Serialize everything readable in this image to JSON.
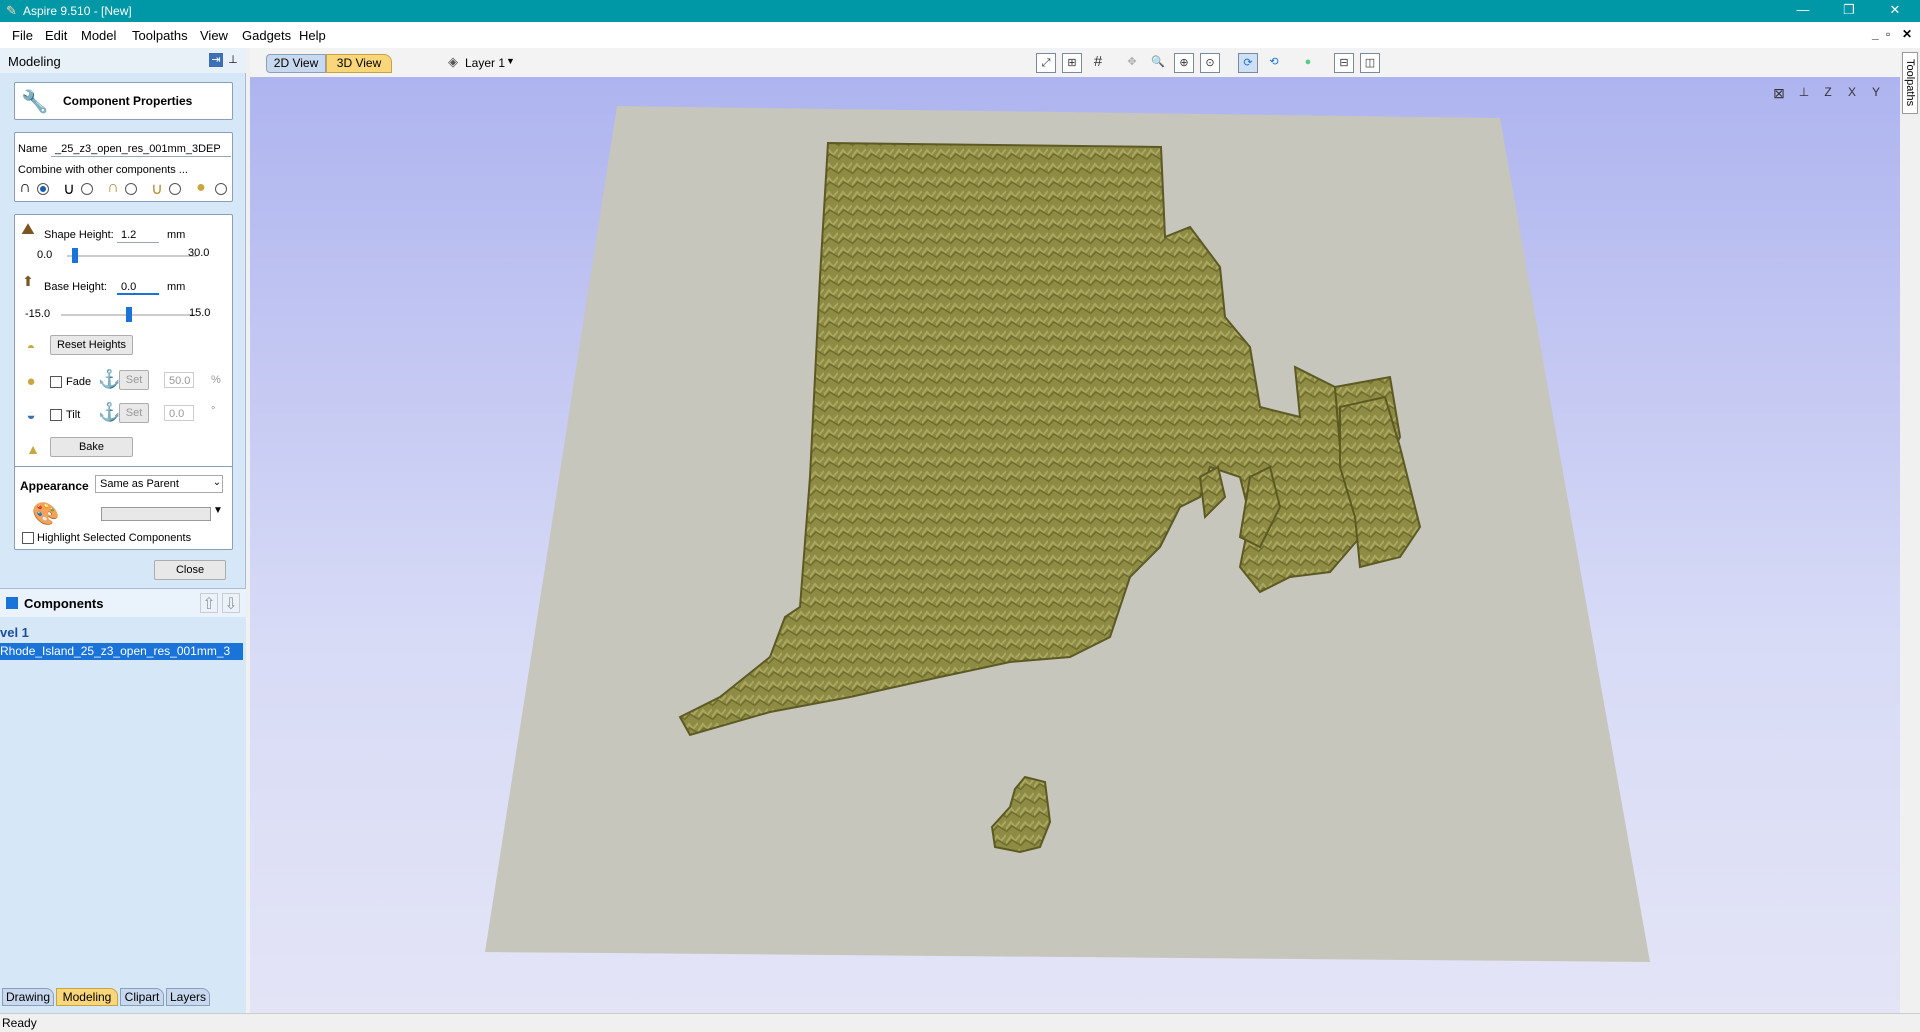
{
  "window": {
    "title": "Aspire 9.510 - [New]"
  },
  "menu": [
    "File",
    "Edit",
    "Model",
    "Toolpaths",
    "View",
    "Gadgets",
    "Help"
  ],
  "panel": {
    "title": "Modeling",
    "component_properties": {
      "heading": "Component Properties",
      "name_label": "Name",
      "name_value": "_25_z3_open_res_001mm_3DEP",
      "combine_label": "Combine with other components ...",
      "shape_height_label": "Shape Height:",
      "shape_height_value": "1.2",
      "shape_height_unit": "mm",
      "shape_min": "0.0",
      "shape_max": "30.0",
      "shape_slider_fraction": 0.04,
      "base_height_label": "Base Height:",
      "base_height_value": "0.0",
      "base_height_unit": "mm",
      "base_min": "-15.0",
      "base_max": "15.0",
      "base_slider_fraction": 0.5,
      "reset_heights": "Reset Heights",
      "fade_label": "Fade",
      "fade_set": "Set",
      "fade_value": "50.0",
      "fade_unit": "%",
      "tilt_label": "Tilt",
      "tilt_set": "Set",
      "tilt_value": "0.0",
      "tilt_unit": "°",
      "bake": "Bake"
    },
    "appearance": {
      "label": "Appearance",
      "selected": "Same as Parent",
      "highlight_label": "Highlight Selected Components"
    },
    "close": "Close",
    "components": {
      "title": "Components",
      "level": "vel 1",
      "item": "Rhode_Island_25_z3_open_res_001mm_3"
    },
    "bottom_tabs": [
      "Drawing",
      "Modeling",
      "Clipart",
      "Layers"
    ],
    "active_bottom_tab": "Modeling"
  },
  "view_tabs": {
    "tab_2d": "2D View",
    "tab_3d": "3D View",
    "layer": "Layer 1"
  },
  "right_rail": {
    "tab": "Toolpaths"
  },
  "status": {
    "text": "Ready"
  },
  "colors": {
    "titlebar": "#0097a7",
    "model": "#8a8a3c",
    "base_plate": "#c6c6c0",
    "active_tab": "#f9d67a"
  }
}
